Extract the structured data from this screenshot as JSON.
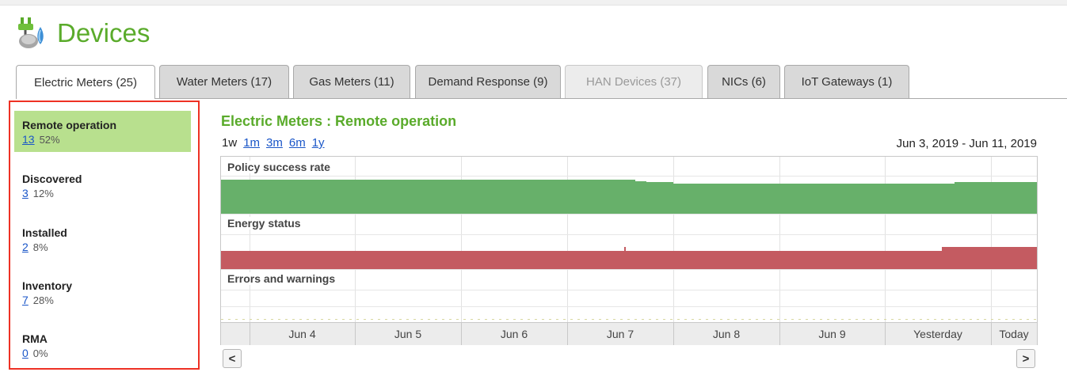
{
  "page": {
    "title": "Devices"
  },
  "tabs": [
    {
      "label": "Electric Meters (25)"
    },
    {
      "label": "Water Meters (17)"
    },
    {
      "label": "Gas Meters (11)"
    },
    {
      "label": "Demand Response (9)"
    },
    {
      "label": "HAN Devices (37)"
    },
    {
      "label": "NICs (6)"
    },
    {
      "label": "IoT Gateways (1)"
    }
  ],
  "sidebar": {
    "items": [
      {
        "label": "Remote operation",
        "count": "13",
        "percent": "52%"
      },
      {
        "label": "Discovered",
        "count": "3",
        "percent": "12%"
      },
      {
        "label": "Installed",
        "count": "2",
        "percent": "8%"
      },
      {
        "label": "Inventory",
        "count": "7",
        "percent": "28%"
      },
      {
        "label": "RMA",
        "count": "0",
        "percent": "0%"
      }
    ]
  },
  "main": {
    "title": "Electric Meters : Remote operation",
    "ranges": {
      "current": "1w",
      "links": [
        "1m",
        "3m",
        "6m",
        "1y"
      ]
    },
    "date_range": "Jun 3, 2019 - Jun 11, 2019"
  },
  "chart": {
    "sections": [
      "Policy success rate",
      "Energy status",
      "Errors and warnings"
    ],
    "x_labels": [
      "Jun 4",
      "Jun 5",
      "Jun 6",
      "Jun 7",
      "Jun 8",
      "Jun 9",
      "Yesterday",
      "Today"
    ],
    "colors": {
      "success": "#67b06a",
      "energy": "#c45b61"
    }
  },
  "nav": {
    "prev": "<",
    "next": ">"
  }
}
